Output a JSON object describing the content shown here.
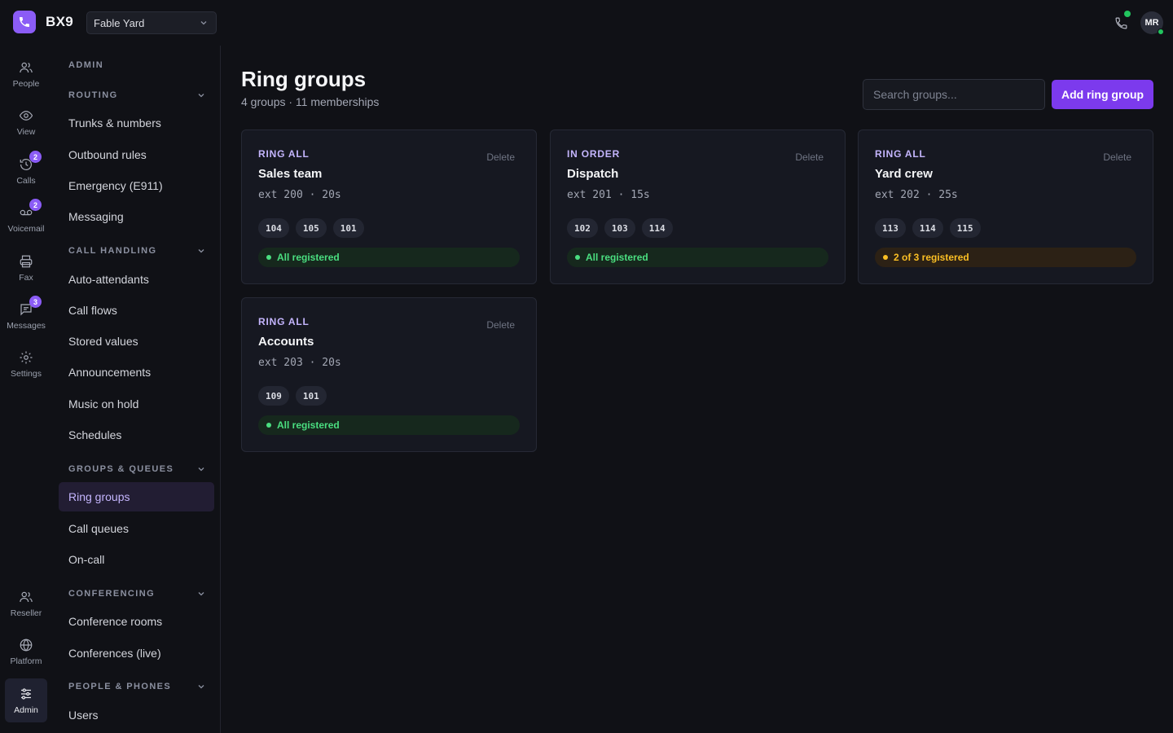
{
  "brand": {
    "name": "BX9"
  },
  "org_select": {
    "value": "Fable Yard"
  },
  "user": {
    "initials": "MR"
  },
  "rail": [
    {
      "label": "People",
      "icon": "people-icon",
      "badge": ""
    },
    {
      "label": "View",
      "icon": "eye-icon",
      "badge": ""
    },
    {
      "label": "Calls",
      "icon": "history-icon",
      "badge": "2"
    },
    {
      "label": "Voicemail",
      "icon": "voicemail-icon",
      "badge": "2"
    },
    {
      "label": "Fax",
      "icon": "printer-icon",
      "badge": ""
    },
    {
      "label": "Messages",
      "icon": "message-icon",
      "badge": "3"
    },
    {
      "label": "Settings",
      "icon": "gear-icon",
      "badge": ""
    },
    {
      "label": "Reseller",
      "icon": "reseller-icon",
      "badge": ""
    },
    {
      "label": "Platform",
      "icon": "globe-icon",
      "badge": ""
    },
    {
      "label": "Admin",
      "icon": "sliders-icon",
      "badge": ""
    }
  ],
  "sidebar": {
    "section": "ADMIN",
    "groups": [
      {
        "title": "ROUTING",
        "items": [
          "Trunks & numbers",
          "Outbound rules",
          "Emergency (E911)",
          "Messaging"
        ]
      },
      {
        "title": "CALL HANDLING",
        "items": [
          "Auto-attendants",
          "Call flows",
          "Stored values",
          "Announcements",
          "Music on hold",
          "Schedules"
        ]
      },
      {
        "title": "GROUPS & QUEUES",
        "items": [
          "Ring groups",
          "Call queues",
          "On-call"
        ]
      },
      {
        "title": "CONFERENCING",
        "items": [
          "Conference rooms",
          "Conferences (live)"
        ]
      },
      {
        "title": "PEOPLE & PHONES",
        "items": [
          "Users"
        ]
      }
    ]
  },
  "page": {
    "title": "Ring groups",
    "subtitle": "4 groups · 11 memberships",
    "search_placeholder": "Search groups...",
    "add_label": "Add ring group",
    "delete_label": "Delete"
  },
  "groups": [
    {
      "strategy": "RING ALL",
      "name": "Sales team",
      "meta": "ext 200 · 20s",
      "members": [
        "104",
        "105",
        "101"
      ],
      "status": "All registered",
      "status_kind": "ok"
    },
    {
      "strategy": "IN ORDER",
      "name": "Dispatch",
      "meta": "ext 201 · 15s",
      "members": [
        "102",
        "103",
        "114"
      ],
      "status": "All registered",
      "status_kind": "ok"
    },
    {
      "strategy": "RING ALL",
      "name": "Yard crew",
      "meta": "ext 202 · 25s",
      "members": [
        "113",
        "114",
        "115"
      ],
      "status": "2 of 3 registered",
      "status_kind": "warn"
    },
    {
      "strategy": "RING ALL",
      "name": "Accounts",
      "meta": "ext 203 · 20s",
      "members": [
        "109",
        "101"
      ],
      "status": "All registered",
      "status_kind": "ok"
    }
  ],
  "colors": {
    "accent": "#7c3aed",
    "ok": "#4ade80",
    "warn": "#fbbf24",
    "online": "#22c55e"
  }
}
